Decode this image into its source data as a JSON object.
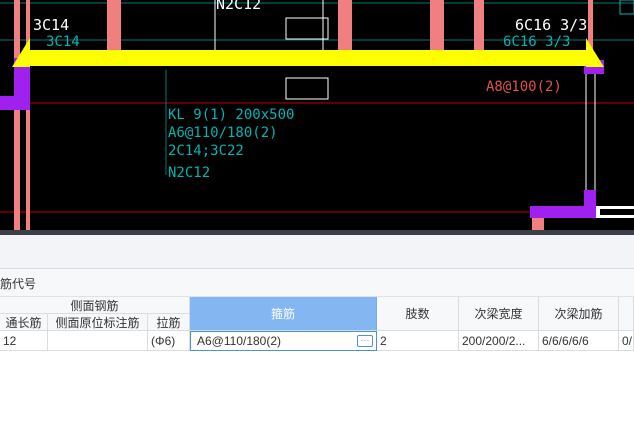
{
  "cad": {
    "label_top_left_white": "3C14",
    "label_top_left_cyan": "3C14",
    "label_top_center": "N2C12",
    "label_top_right_white": "6C16 3/3",
    "label_top_right_cyan": "6C16 3/3",
    "label_right_red": "A8@100(2)",
    "beam_annotation": [
      "KL 9(1) 200x500",
      "A6@110/180(2)",
      "2C14;3C22",
      "N2C12"
    ],
    "colors": {
      "background": "#000000",
      "beam_yellow": "#ffff00",
      "column_salmon": "#f08080",
      "purple": "#a020f0",
      "cyan_text": "#00b4b4",
      "red_line": "#c00000"
    }
  },
  "section_label": "筋代号",
  "table": {
    "group_header": "侧面钢筋",
    "columns": [
      "通长筋",
      "侧面原位标注筋",
      "拉筋",
      "箍筋",
      "肢数",
      "次梁宽度",
      "次梁加筋"
    ],
    "row": {
      "col0": "12",
      "col1": "",
      "col2": "(Φ6)",
      "col3": "A6@110/180(2)",
      "col4": "2",
      "col5": "200/200/2...",
      "col6": "6/6/6/6/6",
      "col7": "0/"
    },
    "more_button": "···"
  }
}
